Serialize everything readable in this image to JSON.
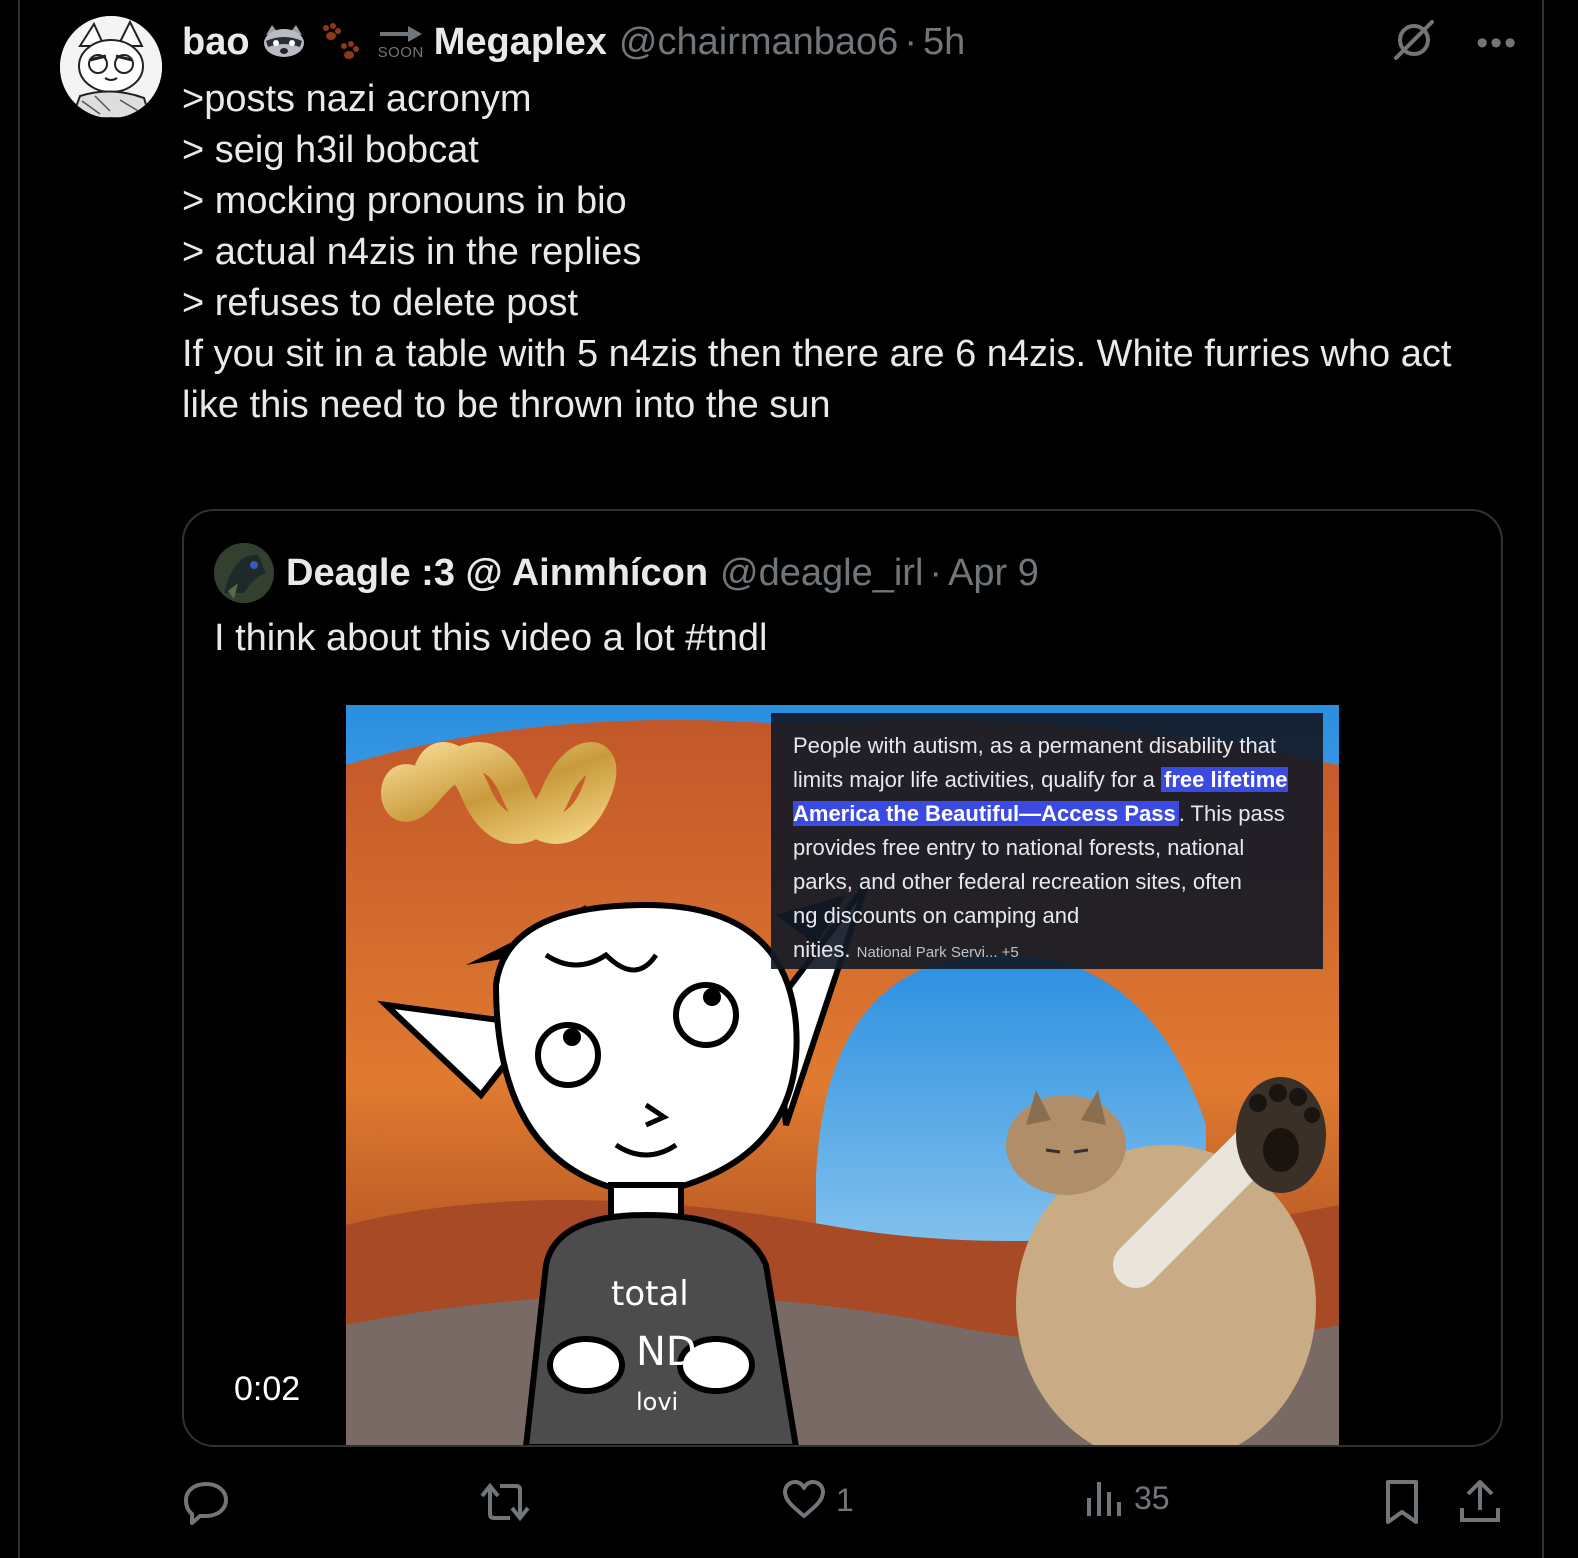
{
  "post": {
    "author_name": "bao",
    "community": "Megaplex",
    "soon_label": "SOON",
    "handle": "@chairmanbao6",
    "separator": "·",
    "time": "5h",
    "lines": [
      ">posts nazi acronym",
      "> seig h3il bobcat",
      "> mocking pronouns in bio",
      "> actual n4zis in the replies",
      "> refuses to delete post",
      "",
      "If you sit in a table with 5 n4zis then there are 6 n4zis. White furries who act",
      "like this need to be thrown into the sun"
    ]
  },
  "quote": {
    "author_name": "Deagle :3 @ Ainmhícon",
    "handle": "@deagle_irl",
    "separator": "·",
    "date": "Apr 9",
    "text": "I think about this video a lot #tndl",
    "video": {
      "duration": "0:02",
      "overlay": {
        "text_before": "People with autism, as a permanent disability that limits major life activities, qualify for a ",
        "highlight": "free lifetime America the Beautiful—Access Pass",
        "text_after": ". This pass provides free entry to national forests, national parks, and other federal recreation sites, often",
        "line_partial": "ng discounts on camping and",
        "line_partial2": "nities.",
        "source": "National Park Servi... +5"
      },
      "shirt_text_1": "total",
      "shirt_text_2": "ND",
      "shirt_text_3": "lovi"
    }
  },
  "actions": {
    "reply_count": "",
    "repost_count": "",
    "like_count": "1",
    "views_count": "35"
  },
  "colors": {
    "background": "#000000",
    "text_primary": "#e7e9ea",
    "text_secondary": "#71767b",
    "border": "#2f3336",
    "highlight": "#3b4ae0"
  }
}
